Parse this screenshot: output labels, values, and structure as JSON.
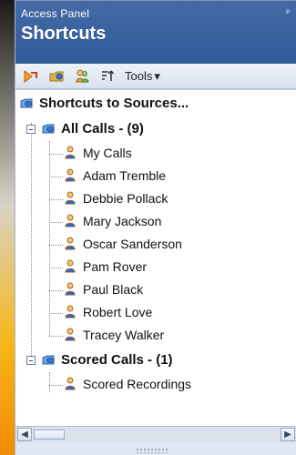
{
  "window": {
    "small_title": "Access Panel",
    "large_title": "Shortcuts",
    "pin_glyph": "ᵖ"
  },
  "toolbar": {
    "buttons": [
      {
        "name": "shortcut-icon"
      },
      {
        "name": "folder-icon"
      },
      {
        "name": "users-icon"
      },
      {
        "name": "sort-icon"
      }
    ],
    "tools_label": "Tools",
    "tools_arrow": "▾"
  },
  "tree": {
    "root_label": "Shortcuts to Sources...",
    "groups": [
      {
        "label": "All Calls - (9)",
        "items": [
          "My Calls",
          "Adam Tremble",
          "Debbie Pollack",
          "Mary Jackson",
          "Oscar Sanderson",
          "Pam Rover",
          "Paul Black",
          "Robert Love",
          "Tracey Walker"
        ]
      },
      {
        "label": "Scored Calls - (1)",
        "items": [
          "Scored Recordings"
        ]
      }
    ]
  },
  "scrollbar": {
    "left_glyph": "◀",
    "right_glyph": "▶"
  }
}
